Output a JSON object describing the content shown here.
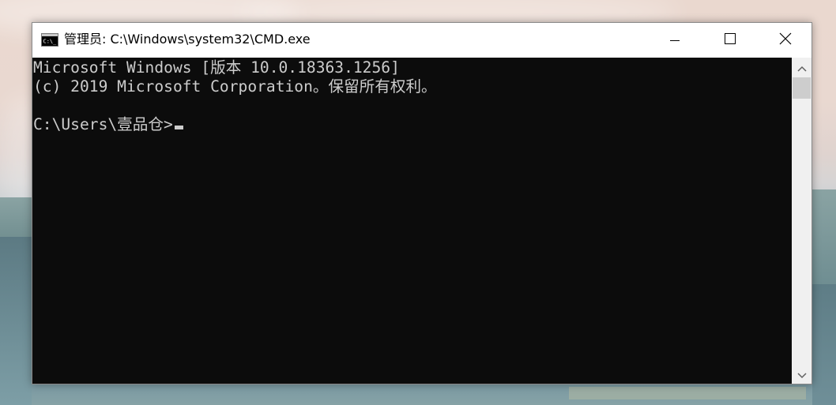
{
  "window": {
    "title": "管理员: C:\\Windows\\system32\\CMD.exe",
    "app_icon": "cmd-icon",
    "controls": {
      "minimize": "minimize-icon",
      "maximize": "maximize-icon",
      "close": "close-icon"
    }
  },
  "console": {
    "lines": [
      "Microsoft Windows [版本 10.0.18363.1256]",
      "(c) 2019 Microsoft Corporation。保留所有权利。",
      "",
      "C:\\Users\\壹品仓>"
    ],
    "background": "#0c0c0c",
    "foreground": "#cccccc"
  },
  "scrollbar": {
    "up": "chevron-up-icon",
    "down": "chevron-down-icon"
  }
}
